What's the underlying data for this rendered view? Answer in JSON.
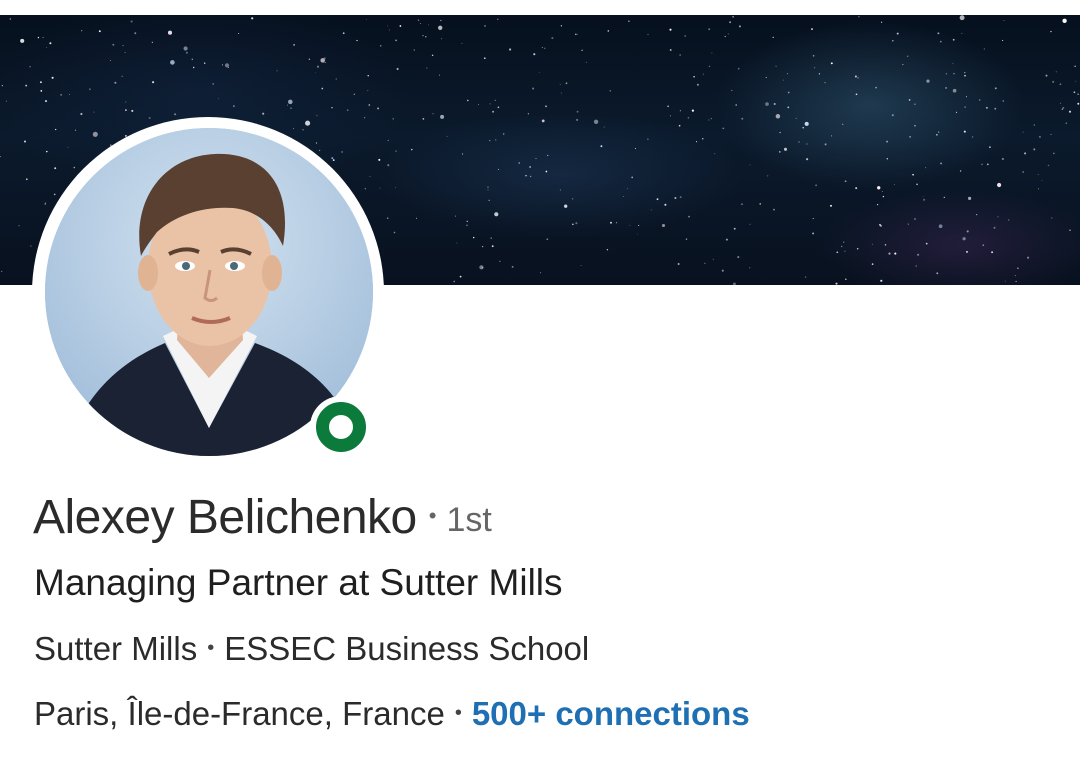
{
  "profile": {
    "name": "Alexey Belichenko",
    "separator": "•",
    "degree": "1st",
    "headline": "Managing Partner at Sutter Mills",
    "company": "Sutter Mills",
    "school": "ESSEC Business School",
    "location": "Paris, Île-de-France, France",
    "connections": "500+ connections",
    "presence_status": "online"
  },
  "colors": {
    "presence": "#0b7a3b",
    "link": "#1f6fb3",
    "banner_base": "#08111f"
  },
  "icons": {
    "presence": "presence-ring-icon"
  }
}
